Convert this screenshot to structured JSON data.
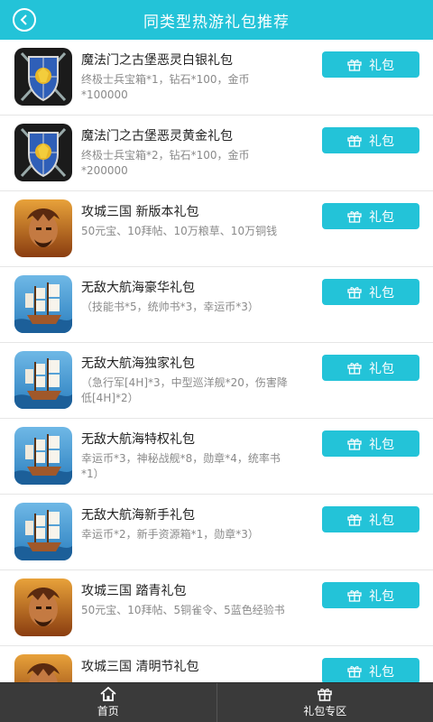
{
  "header": {
    "title": "同类型热游礼包推荐",
    "back_icon": "chevron-left-icon"
  },
  "gift_button_label": "礼包",
  "items": [
    {
      "title": "魔法门之古堡恶灵白银礼包",
      "desc": "终极士兵宝箱*1，钻石*100，金币*100000",
      "thumb": "castle-shield"
    },
    {
      "title": "魔法门之古堡恶灵黄金礼包",
      "desc": "终极士兵宝箱*2，钻石*100，金币*200000",
      "thumb": "castle-shield"
    },
    {
      "title": "攻城三国 新版本礼包",
      "desc": "50元宝、10拜帖、10万粮草、10万铜钱",
      "thumb": "warrior"
    },
    {
      "title": "无敌大航海豪华礼包",
      "desc": "（技能书*5，统帅书*3，幸运币*3）",
      "thumb": "ship"
    },
    {
      "title": "无敌大航海独家礼包",
      "desc": "（急行军[4H]*3，中型巡洋舰*20，伤害降低[4H]*2）",
      "thumb": "ship"
    },
    {
      "title": "无敌大航海特权礼包",
      "desc": "幸运币*3，神秘战舰*8，勋章*4，统率书*1）",
      "thumb": "ship"
    },
    {
      "title": "无敌大航海新手礼包",
      "desc": "幸运币*2，新手资源箱*1，勋章*3）",
      "thumb": "ship"
    },
    {
      "title": "攻城三国 踏青礼包",
      "desc": "50元宝、10拜帖、5铜雀令、5蓝色经验书",
      "thumb": "warrior"
    },
    {
      "title": "攻城三国 清明节礼包",
      "desc": "",
      "thumb": "warrior"
    }
  ],
  "tabbar": {
    "home_label": "首页",
    "gifts_label": "礼包专区"
  },
  "colors": {
    "accent": "#23c3d8",
    "tabbar": "#3a3a3a"
  }
}
